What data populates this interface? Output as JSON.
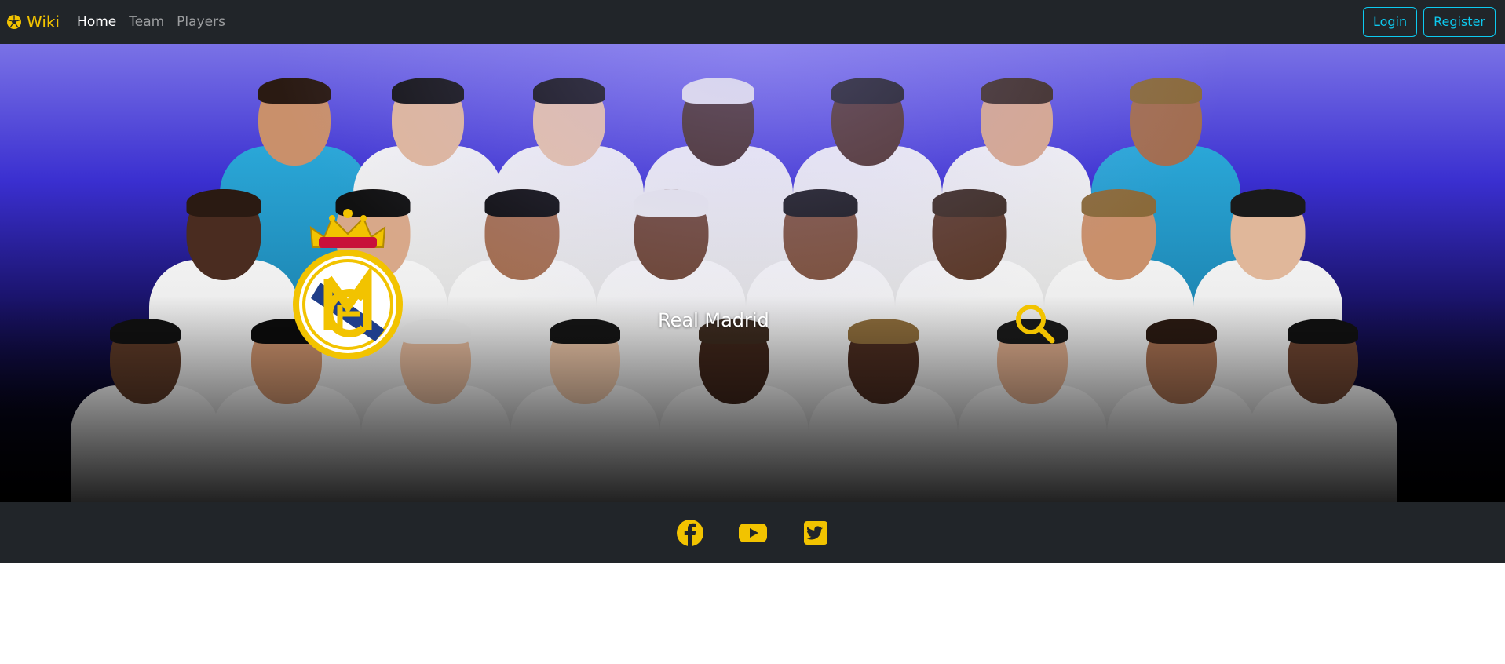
{
  "navbar": {
    "brand_icon": "soccer-ball-icon",
    "brand_text": "Wiki",
    "links": [
      {
        "label": "Home",
        "active": true
      },
      {
        "label": "Team",
        "active": false
      },
      {
        "label": "Players",
        "active": false
      }
    ],
    "login_label": "Login",
    "register_label": "Register"
  },
  "hero": {
    "title": "Real Madrid",
    "crest_icon": "real-madrid-crest-icon",
    "search_icon": "search-icon",
    "indicators": [
      false,
      false,
      true,
      false,
      false,
      false,
      false
    ]
  },
  "footer": {
    "social": [
      "facebook-icon",
      "youtube-icon",
      "twitter-icon"
    ]
  },
  "colors": {
    "accent": "#f2c300",
    "navbar_bg": "#212529",
    "button_outline": "#0dcaf0"
  }
}
